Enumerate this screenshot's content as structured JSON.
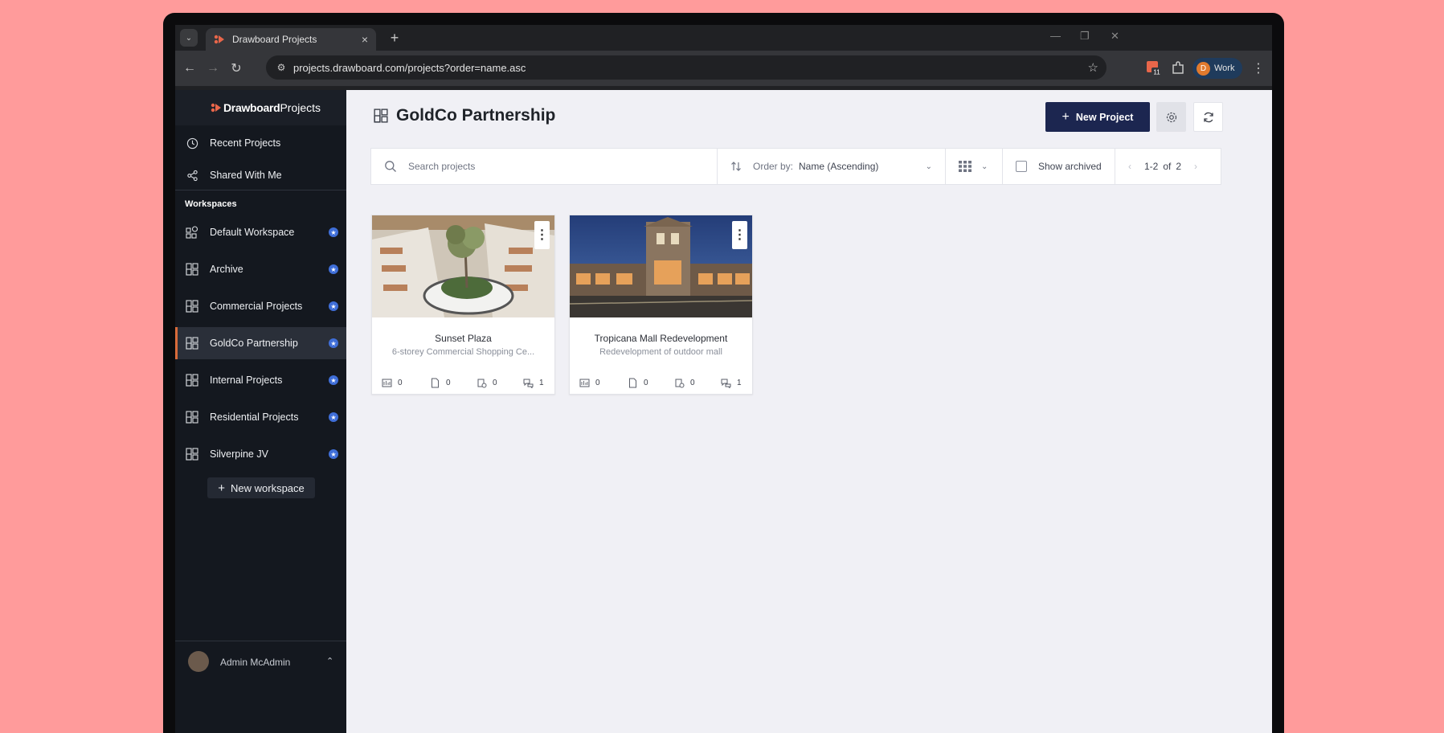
{
  "browser": {
    "tab_title": "Drawboard Projects",
    "new_tab_symbol": "+",
    "url": "projects.drawboard.com/projects?order=name.asc",
    "extension_badge": "11",
    "profile_initial": "D",
    "profile_label": "Work"
  },
  "sidebar": {
    "logo_bold": "Drawboard",
    "logo_light": "Projects",
    "top_items": [
      {
        "label": "Recent Projects",
        "icon": "clock-icon"
      },
      {
        "label": "Shared With Me",
        "icon": "share-icon"
      }
    ],
    "workspaces_heading": "Workspaces",
    "workspaces": [
      {
        "label": "Default Workspace",
        "icon": "workspace-default-icon",
        "starred": true
      },
      {
        "label": "Archive",
        "icon": "workspace-icon",
        "starred": true
      },
      {
        "label": "Commercial Projects",
        "icon": "workspace-icon",
        "starred": true
      },
      {
        "label": "GoldCo Partnership",
        "icon": "workspace-icon",
        "starred": true,
        "active": true
      },
      {
        "label": "Internal Projects",
        "icon": "workspace-icon",
        "starred": true
      },
      {
        "label": "Residential Projects",
        "icon": "workspace-icon",
        "starred": true
      },
      {
        "label": "Silverpine JV",
        "icon": "workspace-icon",
        "starred": true
      }
    ],
    "new_workspace_label": "New workspace",
    "user_name": "Admin McAdmin"
  },
  "main": {
    "title": "GoldCo Partnership",
    "new_project_label": "New Project",
    "search_placeholder": "Search projects",
    "order_by_label": "Order by:",
    "order_by_value": "Name (Ascending)",
    "show_archived_label": "Show archived",
    "pagination_range": "1-2",
    "pagination_of": "of",
    "pagination_total": "2"
  },
  "projects": [
    {
      "title": "Sunset Plaza",
      "description": "6-storey Commercial Shopping Ce...",
      "stats": {
        "drawings": "0",
        "documents": "0",
        "tasks": "0",
        "comments": "1"
      }
    },
    {
      "title": "Tropicana Mall Redevelopment",
      "description": "Redevelopment of outdoor mall",
      "stats": {
        "drawings": "0",
        "documents": "0",
        "tasks": "0",
        "comments": "1"
      }
    }
  ],
  "colors": {
    "accent": "#1c2650",
    "active_marker": "#d96b3a",
    "star_badge": "#3f6ed8",
    "sidebar_bg": "#14181f"
  }
}
